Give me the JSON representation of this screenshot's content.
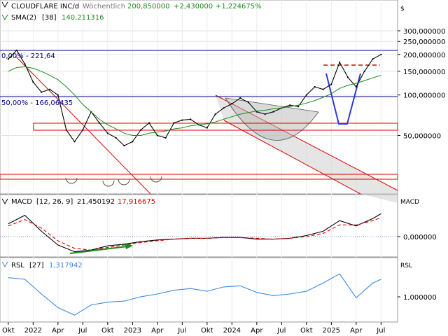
{
  "header": {
    "symbol_label": "CLOUDFLARE INC/d",
    "interval": "Wöchentlich",
    "last_price": "200,850000",
    "change_abs": "+2,430000",
    "change_pct": "+1,224675%",
    "sma_label": "SMA(2)",
    "sma_period": "[38]",
    "sma_value": "140,211316"
  },
  "price_panel": {
    "currency_label": "$",
    "y_ticks": [
      "300,000000",
      "250,000000",
      "200,000000",
      "150,000000",
      "100,000000",
      "50,000000"
    ],
    "fib_labels": [
      "0,00% - 221,64",
      "50,00% - 166,06435"
    ]
  },
  "macd_panel": {
    "title": "MACD",
    "params": "[12, 26, 9]",
    "macd_value": "21,450192",
    "signal_value": "17,916675",
    "right_label": "MACD",
    "y_tick": "0,000000"
  },
  "rsl_panel": {
    "title": "RSL",
    "params": "[27]",
    "value": "1,317942",
    "right_label": "RSL",
    "y_tick": "1,000000"
  },
  "x_axis": {
    "labels": [
      "Okt",
      "2022",
      "Apr",
      "Jul",
      "Okt",
      "2023",
      "Apr",
      "Jul",
      "Okt",
      "2024",
      "Apr",
      "Jul",
      "Okt",
      "2025",
      "Apr",
      "Jul"
    ]
  },
  "colors": {
    "price_line": "#000000",
    "sma_line": "#1a8a1a",
    "macd_line": "#000000",
    "signal_line": "#dd0000",
    "rsl_line": "#3a88dd",
    "support_zone": "#dd0000",
    "fib_line": "#00008b",
    "arrow_green": "#1a8a1a",
    "channel_fill": "#cccccc"
  },
  "chart_data": [
    {
      "type": "line",
      "panel": "price",
      "scale": "log",
      "ylim": [
        20,
        400
      ],
      "x": [
        "2021-10",
        "2021-11",
        "2021-12",
        "2022-01",
        "2022-02",
        "2022-03",
        "2022-04",
        "2022-05",
        "2022-06",
        "2022-07",
        "2022-08",
        "2022-09",
        "2022-10",
        "2022-11",
        "2022-12",
        "2023-01",
        "2023-02",
        "2023-03",
        "2023-04",
        "2023-05",
        "2023-06",
        "2023-07",
        "2023-08",
        "2023-09",
        "2023-10",
        "2023-11",
        "2023-12",
        "2024-01",
        "2024-02",
        "2024-03",
        "2024-04",
        "2024-05",
        "2024-06",
        "2024-07",
        "2024-08",
        "2024-09",
        "2024-10",
        "2024-11",
        "2024-12",
        "2025-01",
        "2025-02",
        "2025-03",
        "2025-04",
        "2025-05",
        "2025-06",
        "2025-07"
      ],
      "series": [
        {
          "values": [
            185,
            215,
            170,
            125,
            105,
            110,
            100,
            55,
            45,
            55,
            75,
            62,
            52,
            48,
            42,
            45,
            55,
            62,
            50,
            48,
            62,
            65,
            66,
            60,
            57,
            72,
            80,
            86,
            95,
            88,
            75,
            72,
            75,
            80,
            84,
            82,
            100,
            115,
            110,
            120,
            175,
            135,
            115,
            150,
            185,
            200
          ]
        },
        {
          "values": [
            150,
            160,
            162,
            158,
            150,
            140,
            130,
            115,
            100,
            85,
            75,
            66,
            60,
            56,
            52,
            50,
            50,
            52,
            53,
            54,
            56,
            57,
            59,
            60,
            61,
            63,
            66,
            69,
            72,
            74,
            76,
            77,
            79,
            80,
            82,
            84,
            87,
            91,
            96,
            102,
            112,
            118,
            122,
            128,
            134,
            140
          ]
        }
      ]
    },
    {
      "type": "line",
      "panel": "macd",
      "x": [
        "2021-10",
        "2021-12",
        "2022-02",
        "2022-04",
        "2022-06",
        "2022-08",
        "2022-10",
        "2022-12",
        "2023-02",
        "2023-04",
        "2023-06",
        "2023-08",
        "2023-10",
        "2023-12",
        "2024-02",
        "2024-04",
        "2024-06",
        "2024-08",
        "2024-10",
        "2024-12",
        "2025-02",
        "2025-04",
        "2025-06",
        "2025-07"
      ],
      "series": [
        {
          "values": [
            12,
            20,
            5,
            -10,
            -18,
            -16,
            -11,
            -9,
            -6,
            -4,
            -3,
            -2,
            -2,
            -1,
            -1,
            -3,
            -3,
            -2,
            1,
            5,
            15,
            10,
            17,
            21.45
          ]
        },
        {
          "values": [
            10,
            16,
            8,
            -5,
            -14,
            -16,
            -13,
            -10,
            -7,
            -5,
            -3,
            -2,
            -2,
            -1,
            -1,
            -2,
            -3,
            -2,
            0,
            3,
            11,
            11,
            15,
            17.92
          ]
        }
      ]
    },
    {
      "type": "line",
      "panel": "rsl",
      "x": [
        "2021-10",
        "2021-12",
        "2022-02",
        "2022-04",
        "2022-06",
        "2022-08",
        "2022-10",
        "2022-12",
        "2023-02",
        "2023-04",
        "2023-06",
        "2023-08",
        "2023-10",
        "2023-12",
        "2024-02",
        "2024-04",
        "2024-06",
        "2024-08",
        "2024-10",
        "2024-12",
        "2025-02",
        "2025-04",
        "2025-06",
        "2025-07"
      ],
      "series": [
        {
          "values": [
            1.35,
            1.32,
            1.05,
            0.8,
            0.66,
            0.85,
            0.9,
            0.92,
            1.0,
            1.05,
            1.12,
            1.15,
            1.1,
            1.18,
            1.2,
            1.08,
            1.02,
            1.05,
            1.1,
            1.25,
            1.42,
            0.98,
            1.25,
            1.32
          ]
        }
      ]
    }
  ]
}
